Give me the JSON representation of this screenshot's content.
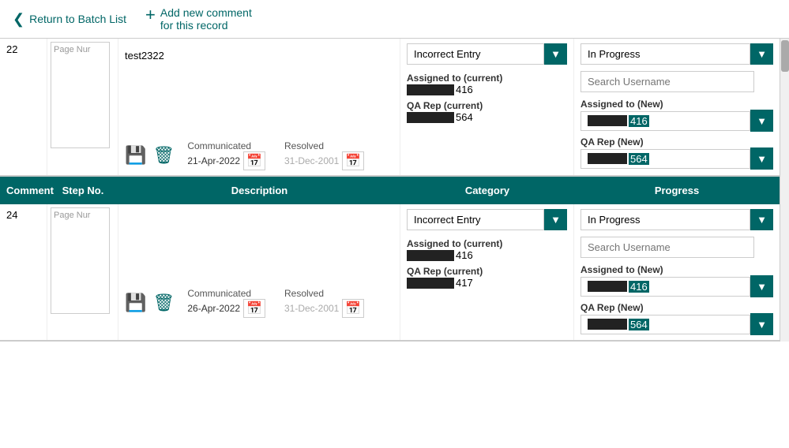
{
  "topbar": {
    "back_label": "Return to Batch List",
    "add_comment_label": "Add new comment\nfor this record"
  },
  "table_header": {
    "comment": "Comment",
    "step_no": "Step No.",
    "description": "Description",
    "category": "Category",
    "progress": "Progress"
  },
  "records": [
    {
      "id": "22",
      "pagenr_label": "Page Nur",
      "description_text": "test2322",
      "communicated_label": "Communicated",
      "communicated_date": "21-Apr-2022",
      "resolved_label": "Resolved",
      "resolved_date": "31-Dec-2001",
      "category_value": "Incorrect Entry",
      "progress_value": "In Progress",
      "search_placeholder": "Search Username",
      "assigned_current_label": "Assigned to (current)",
      "assigned_current_num": "416",
      "assigned_new_label": "Assigned to (New)",
      "assigned_new_num": "416",
      "qa_current_label": "QA Rep (current)",
      "qa_current_num": "564",
      "qa_new_label": "QA Rep (New)",
      "qa_new_num": "564"
    },
    {
      "id": "24",
      "pagenr_label": "Page Nur",
      "description_text": "",
      "communicated_label": "Communicated",
      "communicated_date": "26-Apr-2022",
      "resolved_label": "Resolved",
      "resolved_date": "31-Dec-2001",
      "category_value": "Incorrect Entry",
      "progress_value": "In Progress",
      "search_placeholder": "Search Username",
      "assigned_current_label": "Assigned to (current)",
      "assigned_current_num": "416",
      "assigned_new_label": "Assigned to (New)",
      "assigned_new_num": "416",
      "qa_current_label": "QA Rep (current)",
      "qa_current_num": "417",
      "qa_new_label": "QA Rep (New)",
      "qa_new_num": "564"
    }
  ],
  "icons": {
    "back": "❮",
    "plus": "+",
    "save": "💾",
    "delete": "🗑",
    "calendar": "📅",
    "dropdown": "▼"
  },
  "colors": {
    "teal": "#006666",
    "white": "#ffffff"
  }
}
